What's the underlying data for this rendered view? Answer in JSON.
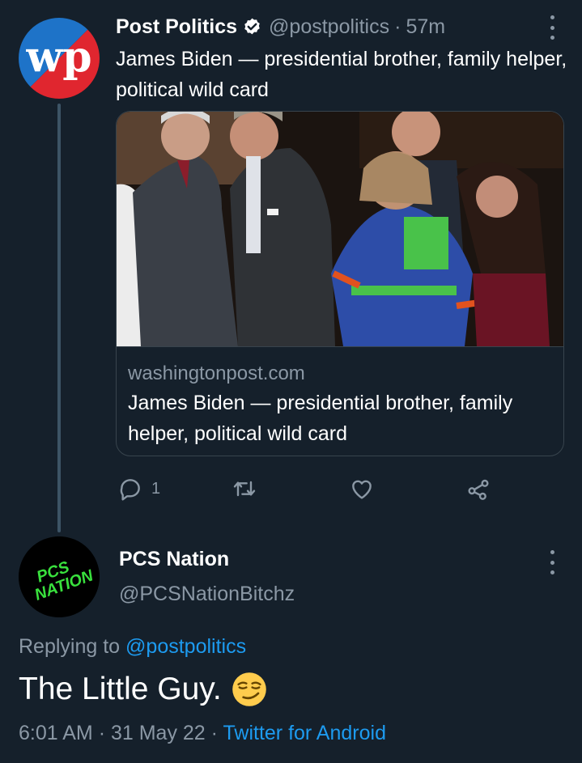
{
  "colors": {
    "background": "#15202b",
    "primary_text": "#ffffff",
    "secondary_text": "#8b98a5",
    "link": "#1d9bf0",
    "border": "#38444d",
    "verified_badge": "#ffffff"
  },
  "tweet": {
    "author_name": "Post Politics",
    "handle": "@postpolitics",
    "separator": "·",
    "time_ago": "57m",
    "avatar_logo_text": "wp",
    "text": "James Biden — presidential brother, family helper, political wild card",
    "card": {
      "domain": "washingtonpost.com",
      "title": "James Biden — presidential brother, family helper, political wild card"
    },
    "actions": {
      "reply_count": "1",
      "reply_icon": "reply-icon",
      "retweet_icon": "retweet-icon",
      "like_icon": "heart-icon",
      "share_icon": "share-icon"
    }
  },
  "reply": {
    "author_name": "PCS Nation",
    "handle": "@PCSNationBitchz",
    "avatar_logo_text": [
      "PCS",
      "NATION"
    ],
    "replying_prefix": "Replying to",
    "replying_to": "@postpolitics",
    "text": "The Little Guy.",
    "emoji": "smirking-face-emoji",
    "time": "6:01 AM",
    "separator": "·",
    "date": "31 May 22",
    "source": "Twitter for Android"
  }
}
